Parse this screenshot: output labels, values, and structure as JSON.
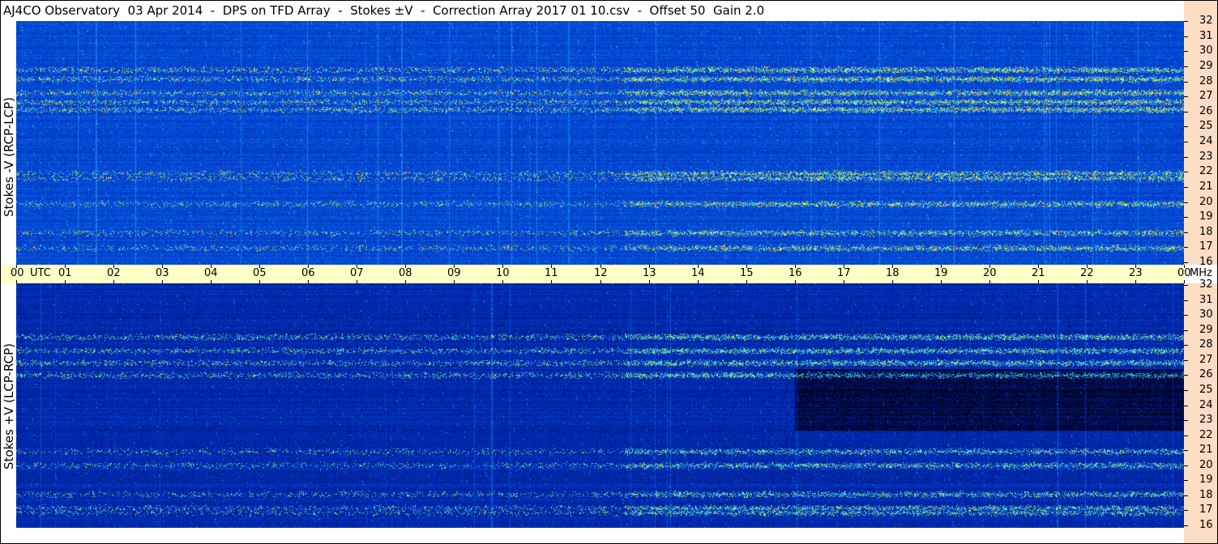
{
  "title": "AJ4CO Observatory  03 Apr 2014  -  DPS on TFD Array  -  Stokes ±V  -  Correction Array 2017 01 10.csv  -  Offset 50  Gain 2.0",
  "colors": {
    "time_axis_bg": "#ffffc8",
    "freq_axis_bg": "#fbdcc4",
    "colormap": [
      "#000010",
      "#001a8c",
      "#0038c8",
      "#0a66e6",
      "#1e96f5",
      "#33d2f0",
      "#96ff8c",
      "#ffff32",
      "#ff8c1e",
      "#ff1e5a"
    ]
  },
  "chart_data": {
    "type": "heatmap",
    "x_axis": {
      "ticks": [
        "00",
        "01",
        "02",
        "03",
        "04",
        "05",
        "06",
        "07",
        "08",
        "09",
        "10",
        "11",
        "12",
        "13",
        "14",
        "15",
        "16",
        "17",
        "18",
        "19",
        "20",
        "21",
        "22",
        "23",
        "00"
      ],
      "unit_label": "UTC",
      "end_unit_label": "MHz",
      "range_hours": [
        0,
        24
      ]
    },
    "panels": [
      {
        "ylabel": "Stokes -V (RCP-LCP)",
        "y_ticks": [
          "16",
          "17",
          "18",
          "19",
          "20",
          "21",
          "22",
          "23",
          "24",
          "25",
          "26",
          "27",
          "28",
          "29",
          "30",
          "31",
          "32"
        ],
        "yrange_mhz": [
          16,
          32
        ],
        "intensity": "higher",
        "bands_mhz": [
          17.1,
          18.1,
          20.0,
          21.7,
          22.0,
          26.2,
          26.7,
          27.3,
          28.2,
          28.8
        ]
      },
      {
        "ylabel": "Stokes +V (LCP-RCP)",
        "y_ticks": [
          "16",
          "17",
          "18",
          "19",
          "20",
          "21",
          "22",
          "23",
          "24",
          "25",
          "26",
          "27",
          "28",
          "29",
          "30",
          "31",
          "32"
        ],
        "yrange_mhz": [
          16,
          32
        ],
        "intensity": "lower",
        "bands_mhz": [
          17.0,
          17.3,
          18.2,
          20.1,
          21.0,
          26.0,
          26.8,
          27.6,
          28.5
        ]
      }
    ]
  }
}
